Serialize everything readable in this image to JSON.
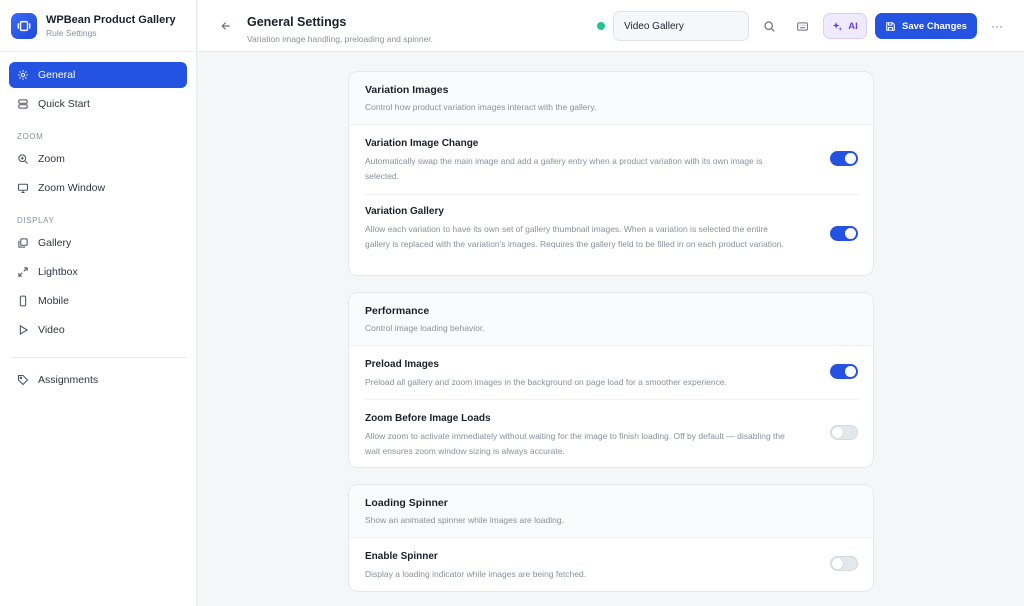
{
  "brand": {
    "title": "WPBean Product Gallery",
    "subtitle": "Rule Settings"
  },
  "sidebar": {
    "items": [
      {
        "label": "General",
        "icon": "gear-icon",
        "active": true
      },
      {
        "label": "Quick Start",
        "icon": "layers-icon"
      }
    ],
    "sections": [
      {
        "title": "ZOOM",
        "items": [
          {
            "label": "Zoom",
            "icon": "zoom-in-icon"
          },
          {
            "label": "Zoom Window",
            "icon": "monitor-icon"
          }
        ]
      },
      {
        "title": "DISPLAY",
        "items": [
          {
            "label": "Gallery",
            "icon": "gallery-icon"
          },
          {
            "label": "Lightbox",
            "icon": "expand-icon"
          },
          {
            "label": "Mobile",
            "icon": "mobile-icon"
          },
          {
            "label": "Video",
            "icon": "play-icon"
          }
        ]
      }
    ],
    "footer_item": {
      "label": "Assignments",
      "icon": "tag-icon"
    }
  },
  "header": {
    "title": "General Settings",
    "subtitle": "Variation image handling, preloading and spinner.",
    "rule_name": "Video Gallery",
    "ai_label": "AI",
    "save_label": "Save Changes",
    "more_label": "···"
  },
  "cards": [
    {
      "title": "Variation Images",
      "description": "Control how product variation images interact with the gallery.",
      "settings": [
        {
          "title": "Variation Image Change",
          "description": "Automatically swap the main image and add a gallery entry when a product variation with its own image is selected.",
          "enabled": true
        },
        {
          "title": "Variation Gallery",
          "description": "Allow each variation to have its own set of gallery thumbnail images. When a variation is selected the entire gallery is replaced with the variation's images. Requires the gallery field to be filled in on each product variation.",
          "enabled": true
        }
      ]
    },
    {
      "title": "Performance",
      "description": "Control image loading behavior.",
      "settings": [
        {
          "title": "Preload Images",
          "description": "Preload all gallery and zoom images in the background on page load for a smoother experience.",
          "enabled": true
        },
        {
          "title": "Zoom Before Image Loads",
          "description": "Allow zoom to activate immediately without waiting for the image to finish loading. Off by default — disabling the wait ensures zoom window sizing is always accurate.",
          "enabled": false
        }
      ]
    },
    {
      "title": "Loading Spinner",
      "description": "Show an animated spinner while images are loading.",
      "settings": [
        {
          "title": "Enable Spinner",
          "description": "Display a loading indicator while images are being fetched.",
          "enabled": false
        }
      ]
    }
  ],
  "colors": {
    "accent": "#2353e0",
    "status": "#22c38e",
    "ai": "#6a3fd8"
  }
}
